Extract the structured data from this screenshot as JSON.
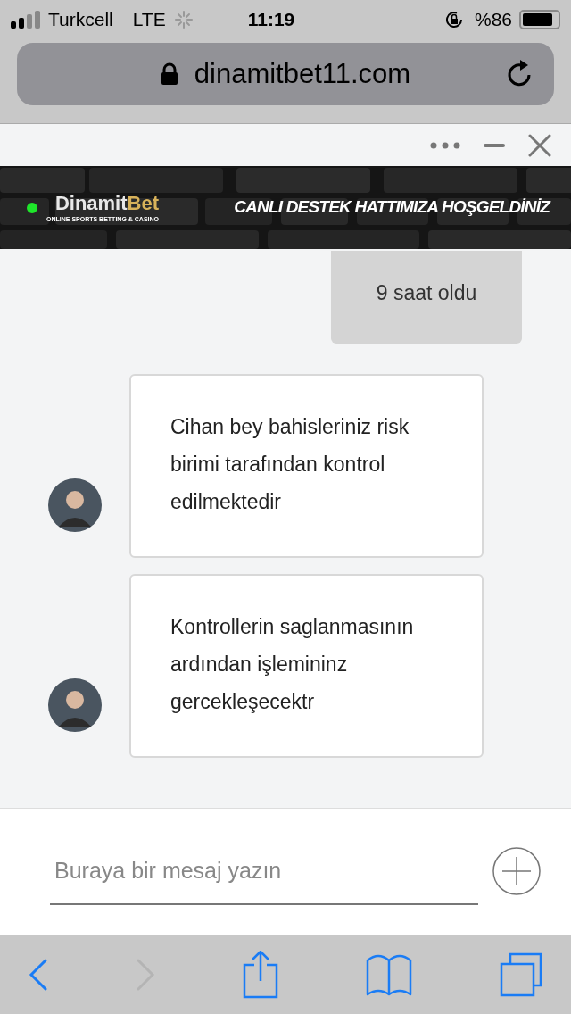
{
  "status_bar": {
    "carrier": "Turkcell",
    "network": "LTE",
    "time": "11:19",
    "battery": "%86"
  },
  "address_bar": {
    "url": "dinamitbet11.com"
  },
  "chat_header": {
    "online": true,
    "logo_main": "Dinamit",
    "logo_accent": "Bet",
    "tagline": "ONLINE SPORTS BETTING & CASINO",
    "headline": "CANLI DESTEK HATTIMIZA HOŞGELDİNİZ"
  },
  "messages": [
    {
      "kind": "outgoing",
      "text": "9 saat oldu"
    },
    {
      "kind": "incoming",
      "text": "Cihan bey bahisleriniz risk birimi tarafından kontrol edilmektedir"
    },
    {
      "kind": "incoming",
      "text": "Kontrollerin saglanmasının ardından işlemininz gercekleşecektr"
    }
  ],
  "composer": {
    "placeholder": "Buraya bir mesaj yazın"
  },
  "toolbar": {
    "back_disabled": false,
    "forward_disabled": true
  }
}
